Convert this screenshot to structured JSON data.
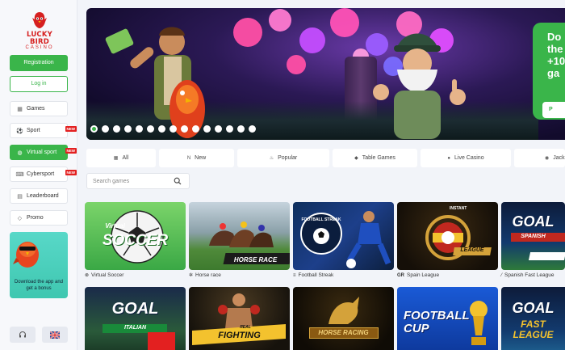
{
  "brand": {
    "name": "LUCKY BIRD",
    "sub": "CASINO"
  },
  "auth": {
    "register_label": "Registration",
    "login_label": "Log in"
  },
  "sidebar": {
    "items": [
      {
        "label": "Games",
        "icon": "grid-icon",
        "new": false,
        "active": false
      },
      {
        "label": "Sport",
        "icon": "ball-icon",
        "new": true,
        "active": false
      },
      {
        "label": "Virtual sport",
        "icon": "virtual-ball-icon",
        "new": true,
        "active": true
      },
      {
        "label": "Cybersport",
        "icon": "gamepad-icon",
        "new": true,
        "active": false
      },
      {
        "label": "Leaderboard",
        "icon": "leaderboard-icon",
        "new": false,
        "active": false
      },
      {
        "label": "Promo",
        "icon": "diamond-icon",
        "new": false,
        "active": false
      }
    ],
    "new_badge": "NEW",
    "promo_text": "Download the app and get a bonus"
  },
  "banner": {
    "panel_lines": [
      "Do",
      "the",
      "+10",
      "ga"
    ],
    "cta_label": "P",
    "slide_count": 15,
    "active_slide": 1
  },
  "tabs": [
    {
      "label": "All",
      "icon": "grid-icon"
    },
    {
      "label": "New",
      "icon": "new-icon"
    },
    {
      "label": "Popular",
      "icon": "fire-icon"
    },
    {
      "label": "Table Games",
      "icon": "diamond-icon"
    },
    {
      "label": "Live Casino",
      "icon": "drop-icon"
    },
    {
      "label": "Jack",
      "icon": "coin-icon"
    }
  ],
  "search": {
    "placeholder": "Search games"
  },
  "games": {
    "row1": [
      {
        "label": "Virtual Soccer",
        "art_title": "SOCCER",
        "art_sub": "Virtual"
      },
      {
        "label": "Horse race",
        "art_title": "HORSE RACE"
      },
      {
        "label": "Football Streak",
        "art_title": "FOOTBALL STREAK"
      },
      {
        "label": "Spain League",
        "art_title": "LEAGUE",
        "art_sub": "INSTANT",
        "prefix": "GR"
      },
      {
        "label": "Spanish Fast League",
        "art_title": "GOAL",
        "art_sub": "SPANISH"
      }
    ],
    "row2": [
      {
        "art_title": "GOAL",
        "art_sub": "ITALIAN"
      },
      {
        "art_title": "FIGHTING",
        "art_sub": "REAL"
      },
      {
        "art_title": "HORSE RACING"
      },
      {
        "art_title": "FOOTBALL CUP"
      },
      {
        "art_title": "GOAL",
        "art_sub": "FAST LEAGUE"
      }
    ]
  },
  "colors": {
    "accent": "#3ab54a",
    "brand_red": "#d62020",
    "badge_red": "#e32020"
  }
}
